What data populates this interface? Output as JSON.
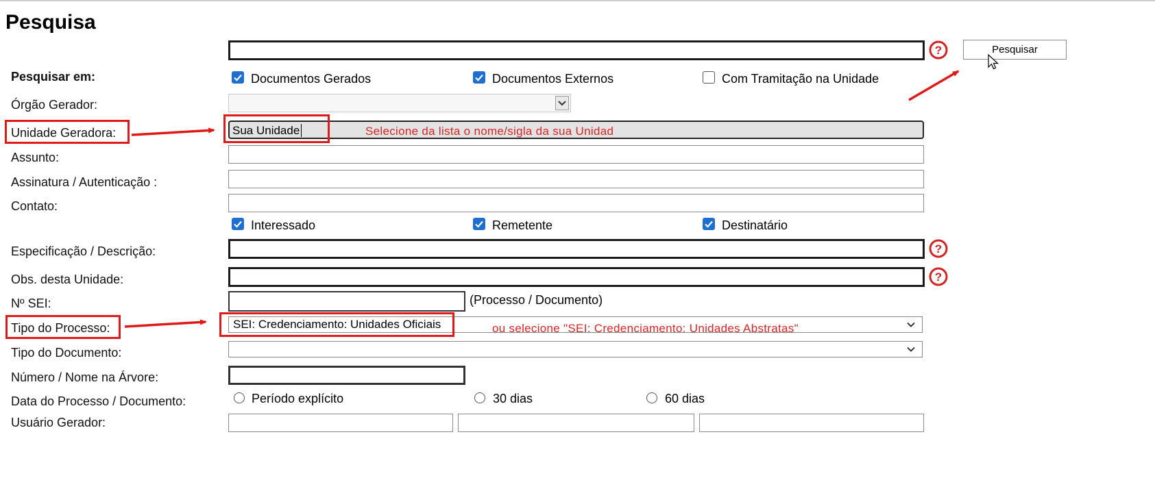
{
  "page": {
    "title": "Pesquisa"
  },
  "search": {
    "button_label": "Pesquisar",
    "search_in_label": "Pesquisar em:",
    "checkboxes": [
      {
        "label": "Documentos Gerados",
        "checked": true
      },
      {
        "label": "Documentos Externos",
        "checked": true
      },
      {
        "label": "Com Tramitação na Unidade",
        "checked": false
      }
    ]
  },
  "fields": {
    "orgao_gerador": {
      "label": "Órgão Gerador:",
      "value": ""
    },
    "unidade_geradora": {
      "label": "Unidade Geradora:",
      "value": "Sua Unidade"
    },
    "assunto": {
      "label": "Assunto:",
      "value": ""
    },
    "assinatura": {
      "label": "Assinatura / Autenticação :",
      "value": ""
    },
    "contato": {
      "label": "Contato:",
      "value": ""
    },
    "contato_options": [
      {
        "label": "Interessado",
        "checked": true
      },
      {
        "label": "Remetente",
        "checked": true
      },
      {
        "label": "Destinatário",
        "checked": true
      }
    ],
    "especificacao": {
      "label": "Especificação / Descrição:",
      "value": ""
    },
    "obs": {
      "label": "Obs. desta Unidade:",
      "value": ""
    },
    "nsei": {
      "label": "Nº SEI:",
      "value": "",
      "hint": "(Processo / Documento)"
    },
    "tipo_processo": {
      "label": "Tipo do Processo:",
      "value": "SEI: Credenciamento: Unidades Oficiais"
    },
    "tipo_documento": {
      "label": "Tipo do Documento:",
      "value": ""
    },
    "numero_arvore": {
      "label": "Número / Nome na Árvore:",
      "value": ""
    },
    "data": {
      "label": "Data do Processo / Documento:",
      "options": [
        {
          "label": "Período explícito",
          "checked": false
        },
        {
          "label": "30 dias",
          "checked": false
        },
        {
          "label": "60 dias",
          "checked": false
        }
      ]
    },
    "usuario_gerador": {
      "label": "Usuário Gerador:",
      "values": [
        "",
        "",
        ""
      ]
    }
  },
  "annotations": {
    "unidade_note": "Selecione da lista o nome/sigla da sua Unidade",
    "tipo_note": "ou selecione \"SEI: Credenciamento: Unidades Abstratas\"",
    "color": "#e01a1a"
  },
  "icons": {
    "help": "help-circle-icon",
    "cursor": "mouse-cursor-icon",
    "chevron": "chevron-down-icon"
  },
  "colors": {
    "checkbox": "#1f6fd1",
    "help": "#d42222"
  }
}
